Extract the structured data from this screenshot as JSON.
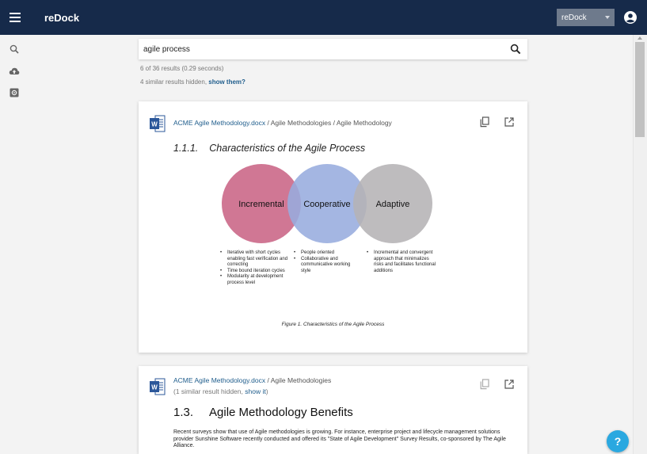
{
  "app": {
    "title": "reDock"
  },
  "header": {
    "workspace_selected": "reDock"
  },
  "search": {
    "query": "agile process"
  },
  "results": {
    "count_text": "6 of 36 results (0.29 seconds)",
    "hidden_text": "4 similar results hidden, ",
    "show_them": "show them?"
  },
  "result1": {
    "file": "ACME Agile Methodology.docx",
    "breadcrumb": " / Agile Methodologies / Agile Methodology",
    "heading_num": "1.1.1.",
    "heading": "Characteristics of the Agile Process",
    "circles": [
      "Incremental",
      "Cooperative",
      "Adaptive"
    ],
    "col1": [
      "Iterative with short cycles enabling fast verification and correcting",
      "Time bound iteration cycles",
      "Modularity at development process level"
    ],
    "col2": [
      "People oriented",
      "Collaborative and communicative working style"
    ],
    "col3": [
      "Incremental and convergent approach that minimalizes risks and facilitates functional additions"
    ],
    "caption": "Figure 1. Characteristics of the Agile Process"
  },
  "result2": {
    "file": "ACME Agile Methodology.docx",
    "breadcrumb": " / Agile Methodologies",
    "similar_text": "(1 similar result hidden, ",
    "show_it": "show it",
    "similar_close": ")",
    "heading_num": "1.3.",
    "heading": "Agile Methodology Benefits",
    "text": "Recent surveys show that use of Agile methodologies is growing. For instance, enterprise project and lifecycle management solutions provider Sunshine Software recently conducted and offered its \"State of Agile Development\" Survey Results, co-sponsored by The Agile Alliance."
  },
  "help": {
    "label": "?"
  },
  "colors": {
    "topbar": "#162a4a",
    "link": "#1f5d8c",
    "incremental": "#cc6b8b",
    "cooperative": "#97acde",
    "adaptive": "#b5b3b5",
    "help": "#2aa8e0"
  },
  "icons": [
    "menu-icon",
    "search-icon",
    "cloud-upload-icon",
    "settings-icon",
    "account-icon",
    "word-file-icon",
    "copy-icon",
    "open-external-icon"
  ]
}
